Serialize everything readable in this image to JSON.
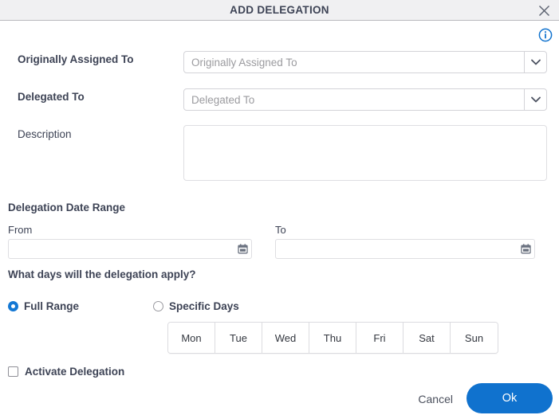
{
  "dialog": {
    "title": "ADD DELEGATION",
    "close_icon": "close-icon",
    "info_icon": "info-icon"
  },
  "fields": {
    "originally_assigned_to": {
      "label": "Originally Assigned To",
      "placeholder": "Originally Assigned To",
      "value": ""
    },
    "delegated_to": {
      "label": "Delegated To",
      "placeholder": "Delegated To",
      "value": ""
    },
    "description": {
      "label": "Description",
      "value": ""
    }
  },
  "date_range": {
    "heading": "Delegation Date Range",
    "from_label": "From",
    "from_value": "",
    "to_label": "To",
    "to_value": "",
    "calendar_icon": "calendar-icon"
  },
  "days": {
    "question": "What days will the delegation apply?",
    "options": [
      {
        "label": "Full Range",
        "selected": true
      },
      {
        "label": "Specific Days",
        "selected": false
      }
    ],
    "day_buttons": [
      "Mon",
      "Tue",
      "Wed",
      "Thu",
      "Fri",
      "Sat",
      "Sun"
    ]
  },
  "activate": {
    "label": "Activate Delegation",
    "checked": false
  },
  "footer": {
    "cancel_label": "Cancel",
    "ok_label": "Ok"
  },
  "colors": {
    "accent_blue": "#1072ce",
    "radio_blue": "#1478d4",
    "titlebar_bg": "#f0f0f2",
    "text_dark": "#3d4355",
    "placeholder_gray": "#9b9b9f",
    "border_gray": "#dedee2"
  }
}
